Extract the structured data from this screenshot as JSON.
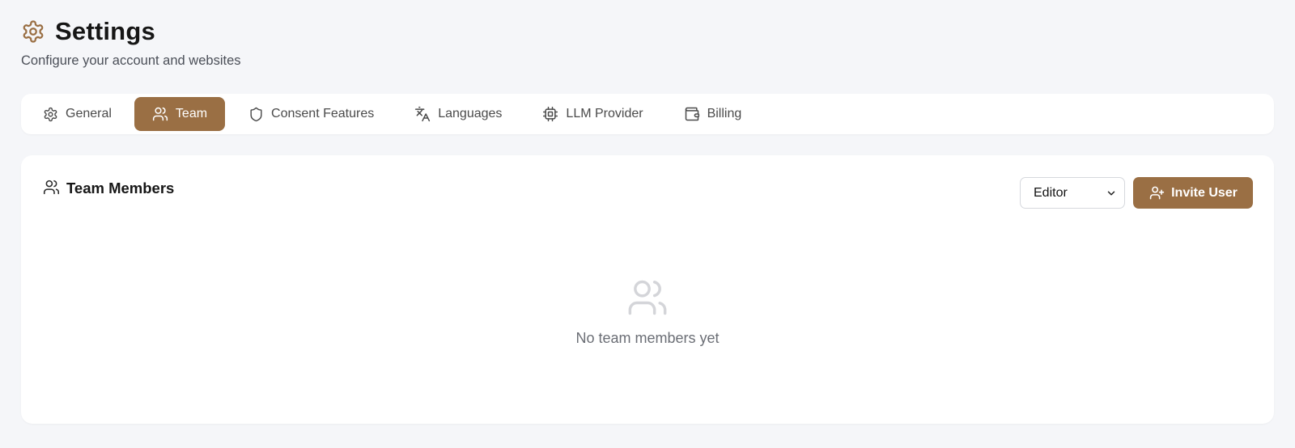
{
  "header": {
    "icon": "gear-icon",
    "title": "Settings",
    "subtitle": "Configure your account and websites"
  },
  "tabs": [
    {
      "label": "General",
      "icon": "gear-icon",
      "active": false
    },
    {
      "label": "Team",
      "icon": "users-icon",
      "active": true
    },
    {
      "label": "Consent Features",
      "icon": "shield-icon",
      "active": false
    },
    {
      "label": "Languages",
      "icon": "translate-icon",
      "active": false
    },
    {
      "label": "LLM Provider",
      "icon": "cpu-icon",
      "active": false
    },
    {
      "label": "Billing",
      "icon": "wallet-icon",
      "active": false
    }
  ],
  "team": {
    "icon": "users-icon",
    "title": "Team Members",
    "role_select": {
      "value": "Editor"
    },
    "invite_button": {
      "label": "Invite User",
      "icon": "user-plus-icon"
    },
    "empty": {
      "icon": "users-icon",
      "message": "No team members yet"
    }
  },
  "colors": {
    "accent": "#9a6f44",
    "background": "#f5f6f9",
    "card": "#ffffff",
    "muted_text": "#6b6e75"
  }
}
